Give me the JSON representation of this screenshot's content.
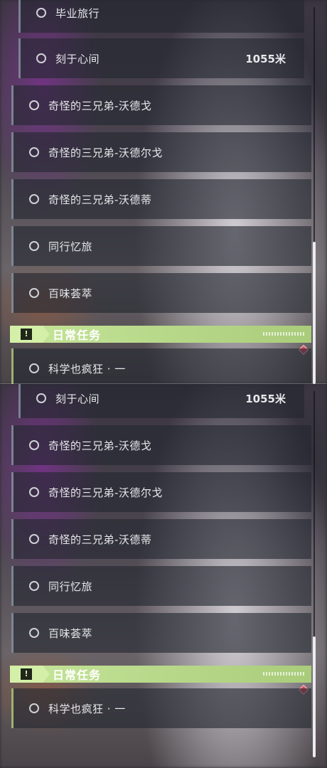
{
  "top_panel": {
    "items": [
      {
        "label": "毕业旅行",
        "distance": ""
      },
      {
        "label": "刻于心间",
        "distance": "1055米"
      },
      {
        "label": "奇怪的三兄弟-沃德戈",
        "distance": ""
      },
      {
        "label": "奇怪的三兄弟-沃德尔戈",
        "distance": ""
      },
      {
        "label": "奇怪的三兄弟-沃德蒂",
        "distance": ""
      },
      {
        "label": "同行忆旅",
        "distance": ""
      },
      {
        "label": "百味荟萃",
        "distance": ""
      }
    ],
    "section_title": "日常任务",
    "daily_items": [
      {
        "label": "科学也疯狂 · 一"
      }
    ]
  },
  "bottom_panel": {
    "items": [
      {
        "label": "刻于心间",
        "distance": "1055米"
      },
      {
        "label": "奇怪的三兄弟-沃德戈",
        "distance": ""
      },
      {
        "label": "奇怪的三兄弟-沃德尔戈",
        "distance": ""
      },
      {
        "label": "奇怪的三兄弟-沃德蒂",
        "distance": ""
      },
      {
        "label": "同行忆旅",
        "distance": ""
      },
      {
        "label": "百味荟萃",
        "distance": ""
      }
    ],
    "section_title": "日常任务",
    "daily_items": [
      {
        "label": "科学也疯狂 · 一"
      }
    ]
  },
  "icons": {
    "quest_status": "circle-ring-icon",
    "section": "exclamation-box-icon",
    "marker": "red-diamond-icon"
  },
  "colors": {
    "section_accent": "#c6e59a",
    "row_bg": "rgba(35,38,48,0.62)",
    "marker": "#e04d5c"
  }
}
